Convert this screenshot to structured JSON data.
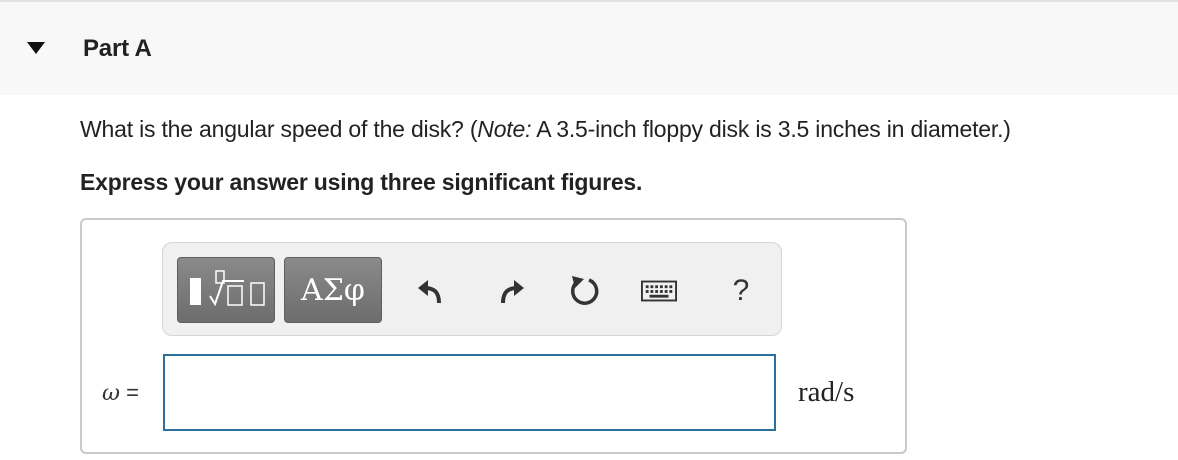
{
  "part": {
    "title": "Part A"
  },
  "question": {
    "text_before": "What is the angular speed of the disk? (",
    "note_label": "Note:",
    "text_after": " A 3.5-inch floppy disk is 3.5 inches in diameter.)"
  },
  "instruction": "Express your answer using three significant figures.",
  "toolbar": {
    "symbols_label": "ΑΣφ",
    "help_label": "?",
    "icons": {
      "toggle": "triangle-down-icon",
      "templates": "templates-icon",
      "undo": "undo-icon",
      "redo": "redo-icon",
      "reset": "reset-icon",
      "keyboard": "keyboard-icon",
      "help": "help-icon"
    }
  },
  "answer": {
    "variable": "ω",
    "equals": "=",
    "value": "",
    "units": "rad/s"
  },
  "colors": {
    "header_bg": "#f8f8f8",
    "toolbar_bg": "#f0f0f0",
    "dark_button": "#777777",
    "input_border": "#2f6f9e"
  }
}
